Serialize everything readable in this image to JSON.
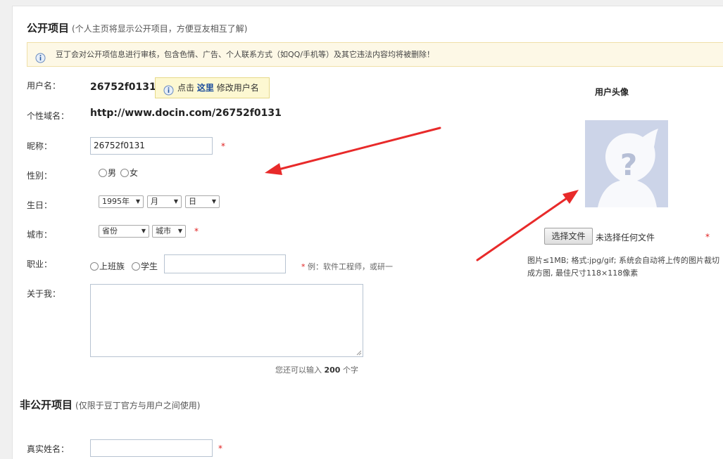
{
  "public_section": {
    "title": "公开项目",
    "subtitle": "(个人主页将显示公开项目，方便豆友相互了解)",
    "notice": "豆丁会对公开项信息进行审核，包含色情、广告、个人联系方式（如QQ/手机等）及其它违法内容均将被删除！"
  },
  "username": {
    "label": "用户名：",
    "value": "26752f0131",
    "hint_prefix": "点击",
    "hint_link": "这里",
    "hint_suffix": "修改用户名"
  },
  "domain": {
    "label": "个性域名：",
    "value": "http://www.docin.com/26752f0131"
  },
  "nickname": {
    "label": "昵称：",
    "value": "26752f0131",
    "required_mark": "*"
  },
  "gender": {
    "label": "性别：",
    "options": [
      "男",
      "女"
    ]
  },
  "birthday": {
    "label": "生日：",
    "year": "1995年",
    "month": "月",
    "day": "日"
  },
  "city": {
    "label": "城市：",
    "province": "省份",
    "city": "城市",
    "required_mark": "*"
  },
  "occupation": {
    "label": "职业：",
    "options": [
      "上班族",
      "学生"
    ],
    "value": "",
    "required_mark": "*",
    "example": "例：软件工程师，或研一"
  },
  "about": {
    "label": "关于我：",
    "value": "",
    "counter_prefix": "您还可以输入",
    "counter_value": "200",
    "counter_suffix": "个字"
  },
  "private_section": {
    "title": "非公开项目",
    "subtitle": "(仅限于豆丁官方与用户之间使用)"
  },
  "realname": {
    "label": "真实姓名：",
    "value": "",
    "required_mark": "*"
  },
  "avatar": {
    "title": "用户头像",
    "choose_file_label": "选择文件",
    "file_status": "未选择任何文件",
    "required_mark": "*",
    "hint": "图片≤1MB; 格式:jpg/gif; 系统会自动将上传的图片裁切成方图, 最佳尺寸118×118像素"
  },
  "colors": {
    "annotation_arrow": "#e82a2a",
    "link": "#1a4c9c",
    "required": "#e02020"
  }
}
